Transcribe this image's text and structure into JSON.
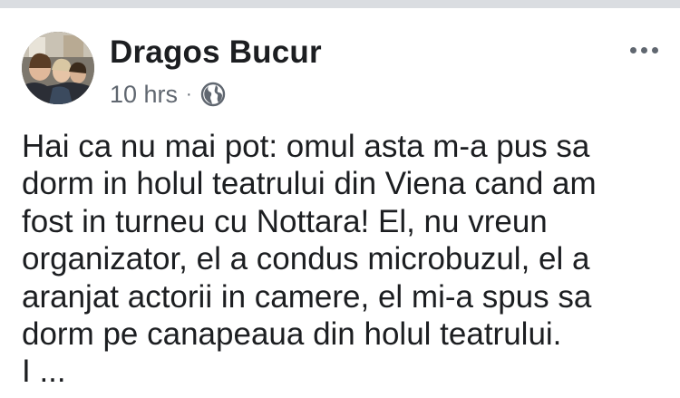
{
  "post": {
    "author": "Dragos Bucur",
    "time": "10 hrs",
    "separator": "·",
    "privacy_icon": "globe-icon",
    "more_icon": "more-options-icon",
    "text_lines": [
      "Hai ca nu mai pot: omul asta m-a pus sa",
      "dorm in holul teatrului din Viena cand am",
      "fost in turneu cu Nottara! El, nu vreun",
      "organizator, el a condus microbuzul, el a",
      "aranjat actorii in camere, el mi-a spus sa",
      "dorm pe canapeaua din holul teatrului.",
      "I ..."
    ]
  },
  "colors": {
    "top_bar": "#dadde1",
    "text_primary": "#1c1e21",
    "text_secondary": "#606770",
    "background": "#ffffff"
  }
}
